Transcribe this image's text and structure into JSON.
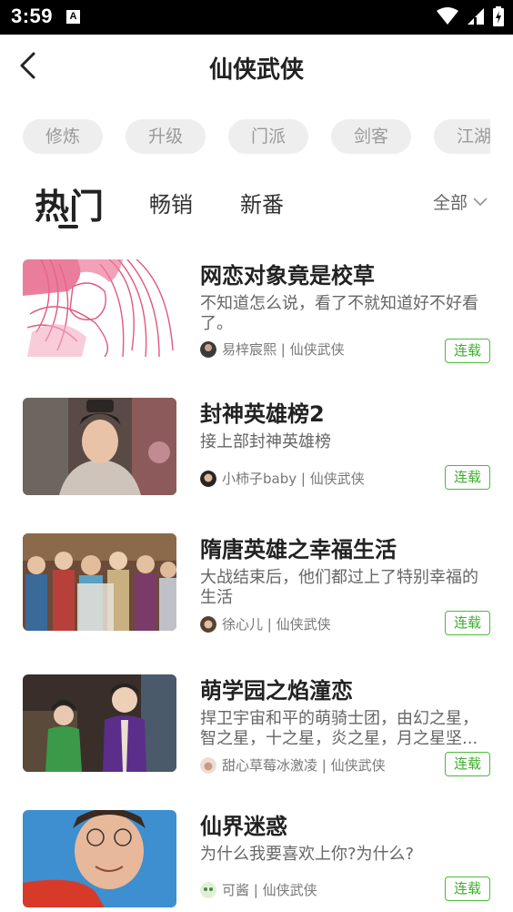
{
  "status_bar": {
    "time": "3:59",
    "notification_glyph": "A",
    "icons": [
      "wifi-icon",
      "signal-icon",
      "battery-icon"
    ]
  },
  "header": {
    "title": "仙侠武侠",
    "back_icon": "chevron-left-icon"
  },
  "tags": [
    "修炼",
    "升级",
    "门派",
    "剑客",
    "江湖"
  ],
  "tabs": [
    {
      "label": "热门",
      "active": true
    },
    {
      "label": "畅销",
      "active": false
    },
    {
      "label": "新番",
      "active": false
    }
  ],
  "filter": {
    "label": "全部",
    "icon": "chevron-down-icon"
  },
  "colors": {
    "accent_green": "#3fae2e",
    "tag_bg": "#eeeeee"
  },
  "items": [
    {
      "title": "网恋对象竟是校草",
      "desc": "不知道怎么说，看了不就知道好不好看了。",
      "meta": "易梓宸熙 | 仙侠武侠",
      "status": "连载"
    },
    {
      "title": "封神英雄榜2",
      "desc": "接上部封神英雄榜",
      "meta": "小柿子baby | 仙侠武侠",
      "status": "连载"
    },
    {
      "title": "隋唐英雄之幸福生活",
      "desc": "大战结束后，他们都过上了特别幸福的生活",
      "meta": "徐心儿 | 仙侠武侠",
      "status": "连载"
    },
    {
      "title": "萌学园之焰潼恋",
      "desc": "捍卫宇宙和平的萌骑士团，由幻之星，智之星，十之星，炎之星，月之星坚...",
      "meta": "甜心草莓冰激凌 | 仙侠武侠",
      "status": "连载"
    },
    {
      "title": "仙界迷惑",
      "desc": "为什么我要喜欢上你?为什么?",
      "meta": "可酱 | 仙侠武侠",
      "status": "连载"
    }
  ]
}
